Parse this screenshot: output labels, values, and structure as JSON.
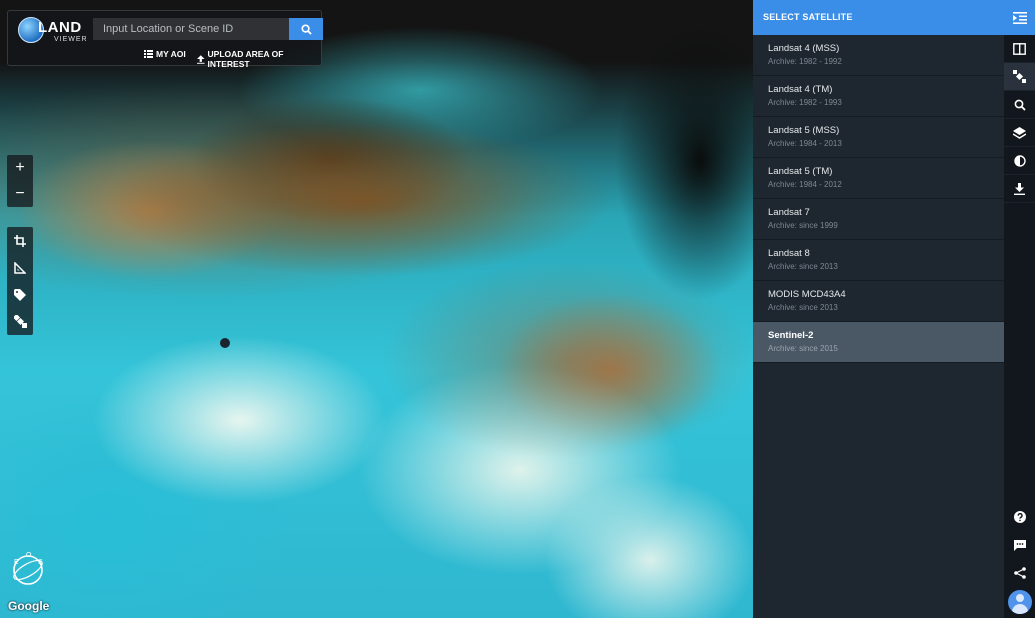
{
  "app": {
    "logo_text": "LAND",
    "logo_subtext": "VIEWER"
  },
  "search": {
    "placeholder": "Input Location or Scene ID",
    "my_aoi_label": "MY AOI",
    "upload_label": "UPLOAD AREA OF INTEREST"
  },
  "map": {
    "zoom_in": "+",
    "zoom_out": "−",
    "attribution": "Google"
  },
  "satellite_panel": {
    "title": "SELECT SATELLITE",
    "items": [
      {
        "name": "Landsat 4 (MSS)",
        "archive": "Archive: 1982 - 1992"
      },
      {
        "name": "Landsat 4 (TM)",
        "archive": "Archive: 1982 - 1993"
      },
      {
        "name": "Landsat 5 (MSS)",
        "archive": "Archive: 1984 - 2013"
      },
      {
        "name": "Landsat 5 (TM)",
        "archive": "Archive: 1984 - 2012"
      },
      {
        "name": "Landsat 7",
        "archive": "Archive: since 1999"
      },
      {
        "name": "Landsat 8",
        "archive": "Archive: since 2013"
      },
      {
        "name": "MODIS MCD43A4",
        "archive": "Archive: since 2013"
      },
      {
        "name": "Sentinel-2",
        "archive": "Archive: since 2015",
        "selected": true
      }
    ]
  },
  "colors": {
    "accent": "#3b8ee8",
    "panel_bg": "#1e2730",
    "rail_bg": "#12171d",
    "selected_bg": "#4a5866"
  }
}
